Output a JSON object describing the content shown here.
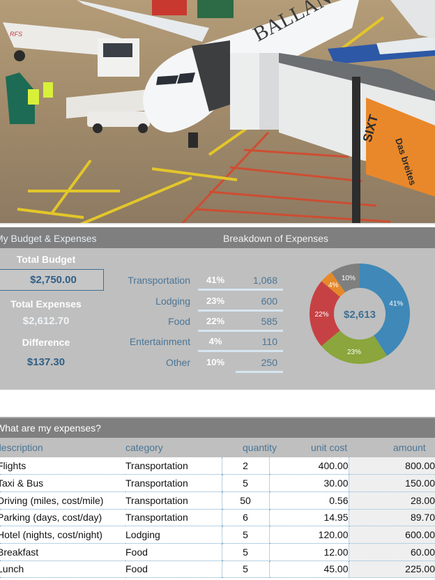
{
  "hero": {
    "image_description": "Airport apron with white airliner at jet bridge, fuel truck, baggage loader and ground crew",
    "aircraft_livery_text": "BALLAN",
    "jetbridge_sign_text": "Das breites Angebot von",
    "jetbridge_sign_brand": "SIXT"
  },
  "budget_panel": {
    "left_title": "My Budget & Expenses",
    "right_title": "Breakdown of Expenses",
    "total_budget_label": "Total Budget",
    "total_budget_value": "$2,750.00",
    "total_expenses_label": "Total Expenses",
    "total_expenses_value": "$2,612.70",
    "difference_label": "Difference",
    "difference_value": "$137.30",
    "breakdown": [
      {
        "label": "Transportation",
        "percent": "41%",
        "amount": "1,068"
      },
      {
        "label": "Lodging",
        "percent": "23%",
        "amount": "600"
      },
      {
        "label": "Food",
        "percent": "22%",
        "amount": "585"
      },
      {
        "label": "Entertainment",
        "percent": "4%",
        "amount": "110"
      },
      {
        "label": "Other",
        "percent": "10%",
        "amount": "250"
      }
    ]
  },
  "chart_data": {
    "type": "pie",
    "style": "donut",
    "center_label": "$2,613",
    "categories": [
      "Transportation",
      "Lodging",
      "Food",
      "Entertainment",
      "Other"
    ],
    "values": [
      1068,
      600,
      585,
      110,
      250
    ],
    "labels": [
      "41%",
      "23%",
      "22%",
      "4%",
      "10%"
    ],
    "colors": [
      "#3f88b8",
      "#8aa63c",
      "#c64144",
      "#e6892a",
      "#7f7f7f"
    ],
    "start": "12 o'clock, clockwise"
  },
  "expenses": {
    "title": "What are my expenses?",
    "columns": [
      "description",
      "category",
      "quantity",
      "unit cost",
      "amount"
    ],
    "rows": [
      {
        "description": "Flights",
        "category": "Transportation",
        "quantity": "2",
        "unit_cost": "400.00",
        "amount": "800.00"
      },
      {
        "description": "Taxi & Bus",
        "category": "Transportation",
        "quantity": "5",
        "unit_cost": "30.00",
        "amount": "150.00"
      },
      {
        "description": "Driving (miles, cost/mile)",
        "category": "Transportation",
        "quantity": "50",
        "unit_cost": "0.56",
        "amount": "28.00"
      },
      {
        "description": "Parking (days, cost/day)",
        "category": "Transportation",
        "quantity": "6",
        "unit_cost": "14.95",
        "amount": "89.70"
      },
      {
        "description": "Hotel (nights, cost/night)",
        "category": "Lodging",
        "quantity": "5",
        "unit_cost": "120.00",
        "amount": "600.00"
      },
      {
        "description": "Breakfast",
        "category": "Food",
        "quantity": "5",
        "unit_cost": "12.00",
        "amount": "60.00"
      },
      {
        "description": "Lunch",
        "category": "Food",
        "quantity": "5",
        "unit_cost": "45.00",
        "amount": "225.00"
      }
    ]
  }
}
